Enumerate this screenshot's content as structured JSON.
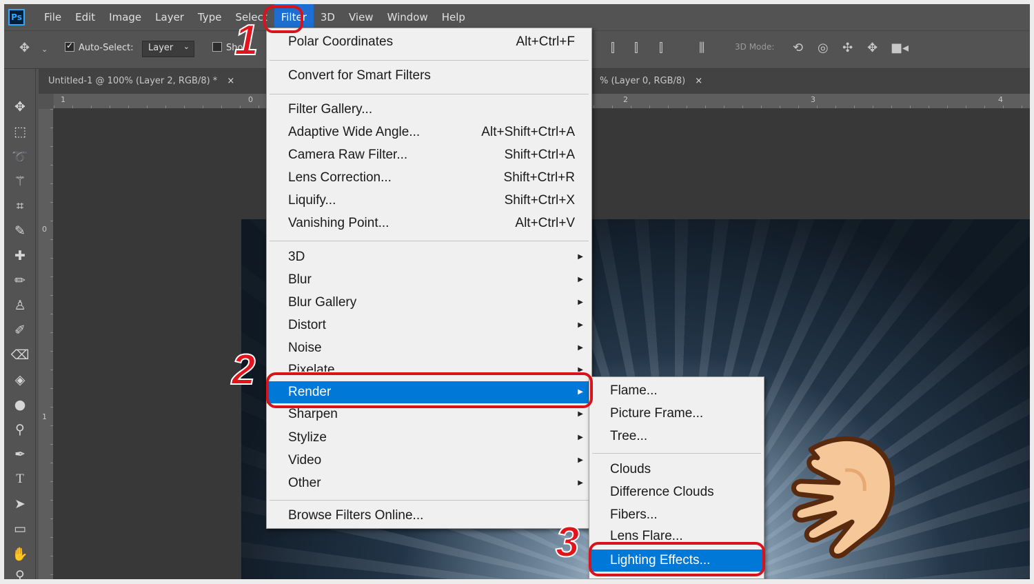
{
  "app": {
    "logo_text": "Ps"
  },
  "menubar": {
    "items": [
      "File",
      "Edit",
      "Image",
      "Layer",
      "Type",
      "Select",
      "Filter",
      "3D",
      "View",
      "Window",
      "Help"
    ],
    "active": "Filter"
  },
  "options": {
    "auto_select_label": "Auto-Select:",
    "layer_select_value": "Layer",
    "show_label": "Sho",
    "mode_label": "3D Mode:"
  },
  "tabs": [
    {
      "title": "Untitled-1 @ 100% (Layer 2, RGB/8) *",
      "close": "×"
    },
    {
      "title": "% (Layer 0, RGB/8)",
      "close": "×"
    }
  ],
  "rulers": {
    "h": [
      "1",
      "0",
      "2",
      "3",
      "4"
    ],
    "v": [
      "0",
      "1"
    ]
  },
  "filter_menu": {
    "items": [
      {
        "label": "Polar Coordinates",
        "shortcut": "Alt+Ctrl+F"
      },
      {
        "label": "Convert for Smart Filters",
        "shortcut": ""
      },
      {
        "label": "Filter Gallery...",
        "shortcut": ""
      },
      {
        "label": "Adaptive Wide Angle...",
        "shortcut": "Alt+Shift+Ctrl+A"
      },
      {
        "label": "Camera Raw Filter...",
        "shortcut": "Shift+Ctrl+A"
      },
      {
        "label": "Lens Correction...",
        "shortcut": "Shift+Ctrl+R"
      },
      {
        "label": "Liquify...",
        "shortcut": "Shift+Ctrl+X"
      },
      {
        "label": "Vanishing Point...",
        "shortcut": "Alt+Ctrl+V"
      },
      {
        "label": "3D",
        "shortcut": ""
      },
      {
        "label": "Blur",
        "shortcut": ""
      },
      {
        "label": "Blur Gallery",
        "shortcut": ""
      },
      {
        "label": "Distort",
        "shortcut": ""
      },
      {
        "label": "Noise",
        "shortcut": ""
      },
      {
        "label": "Pixelate",
        "shortcut": ""
      },
      {
        "label": "Render",
        "shortcut": ""
      },
      {
        "label": "Sharpen",
        "shortcut": ""
      },
      {
        "label": "Stylize",
        "shortcut": ""
      },
      {
        "label": "Video",
        "shortcut": ""
      },
      {
        "label": "Other",
        "shortcut": ""
      },
      {
        "label": "Browse Filters Online...",
        "shortcut": ""
      }
    ],
    "highlighted": "Render"
  },
  "render_submenu": {
    "items": [
      "Flame...",
      "Picture Frame...",
      "Tree...",
      "Clouds",
      "Difference Clouds",
      "Fibers...",
      "Lens Flare...",
      "Lighting Effects..."
    ],
    "highlighted": "Lighting Effects..."
  },
  "annotations": {
    "step1": "1",
    "step2": "2",
    "step3": "3"
  },
  "colors": {
    "highlight": "#0078d7",
    "annotation": "#e3121b",
    "panel": "#535353"
  }
}
